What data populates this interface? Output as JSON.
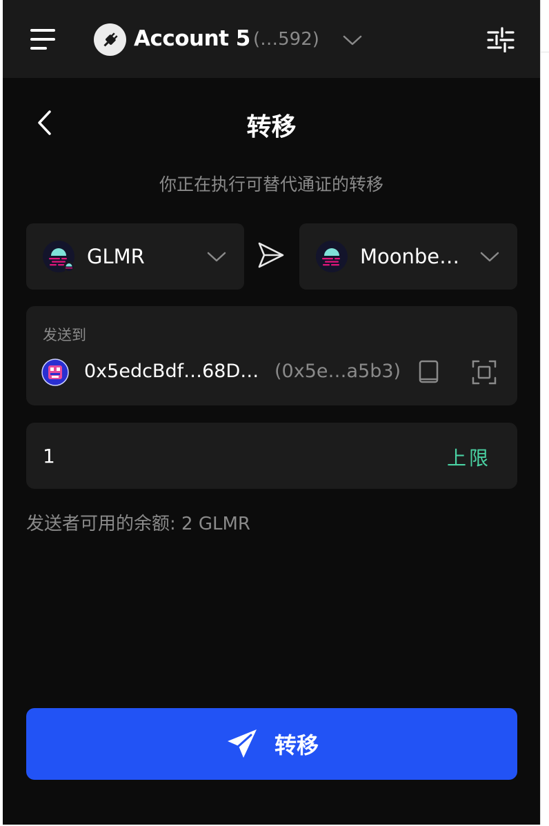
{
  "header": {
    "account_name": "Account 5",
    "account_address": "(…592)"
  },
  "page": {
    "title": "转移",
    "subtitle": "你正在执行可替代通证的转移"
  },
  "token_selector": {
    "label": "GLMR"
  },
  "network_selector": {
    "label": "Moonbe…"
  },
  "recipient": {
    "label": "发送到",
    "address": "0x5edcBdf…68D…",
    "short_address": "(0x5e…a5b3)"
  },
  "amount": {
    "value": "1",
    "max_label": "上限"
  },
  "balance_text": "发送者可用的余额: 2 GLMR",
  "submit": {
    "label": "转移"
  },
  "colors": {
    "accent": "#2253f5",
    "max_text": "#4ad2a3",
    "panel": "#1c1c1c",
    "background": "#0c0c0c"
  }
}
